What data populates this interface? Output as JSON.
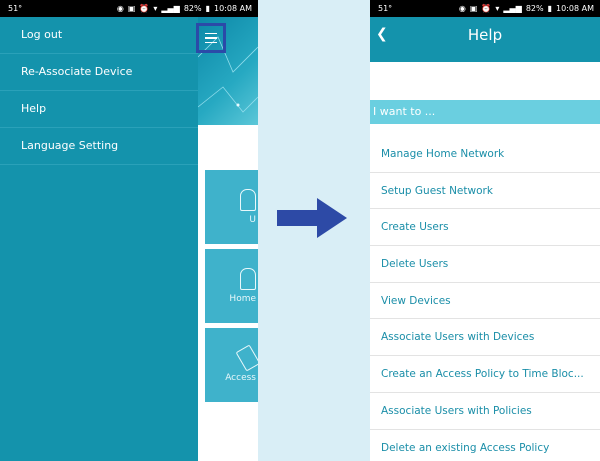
{
  "status_bar": {
    "left": {
      "temp": "51°"
    },
    "right": {
      "battery": "82%",
      "time": "10:08 AM"
    }
  },
  "status_bar_right_phone": {
    "left": {
      "temp": "51°"
    },
    "right": {
      "battery": "82%",
      "time": "10:08 AM"
    }
  },
  "drawer": {
    "items": [
      {
        "label": "Log out"
      },
      {
        "label": "Re-Associate Device"
      },
      {
        "label": "Help"
      },
      {
        "label": "Language Setting"
      }
    ]
  },
  "tiles": [
    {
      "label": "U"
    },
    {
      "label": "Home"
    },
    {
      "label": "Access"
    }
  ],
  "help_screen": {
    "title": "Help",
    "section_label": "I want to ...",
    "items": [
      {
        "label": "Manage Home Network"
      },
      {
        "label": "Setup Guest Network"
      },
      {
        "label": "Create Users"
      },
      {
        "label": "Delete Users"
      },
      {
        "label": "View Devices"
      },
      {
        "label": "Associate Users with Devices"
      },
      {
        "label": "Create an Access Policy to Time Bloc..."
      },
      {
        "label": "Associate Users with Policies"
      },
      {
        "label": "Delete an existing Access Policy"
      }
    ]
  },
  "colors": {
    "primary": "#1493ac",
    "section": "#6acfe0",
    "highlight_border": "#2b4aa8",
    "arrow": "#2d4aa6"
  },
  "icons": {
    "menu": "hamburger-menu-icon",
    "arrow": "right-arrow-icon",
    "back": "chevron-left-icon"
  }
}
